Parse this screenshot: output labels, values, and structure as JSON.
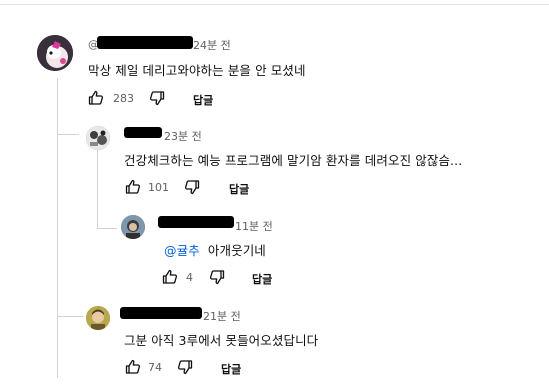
{
  "comments": [
    {
      "time": "24분 전",
      "text": "막상 제일 데리고와야하는 분을 안 모셨네",
      "likes": "283",
      "reply_label": "답글"
    },
    {
      "time": "23분 전",
      "text": "건강체크하는 예능 프로그램에 말기암 환자를 데려오진 않잖슴...",
      "likes": "101",
      "reply_label": "답글"
    },
    {
      "time": "11분 전",
      "mention": "@귤추",
      "text": "아개웃기네",
      "likes": "4",
      "reply_label": "답글"
    },
    {
      "time": "21분 전",
      "text": "그분 아직 3루에서 못들어오셨답니다",
      "likes": "74",
      "reply_label": "답글"
    }
  ]
}
